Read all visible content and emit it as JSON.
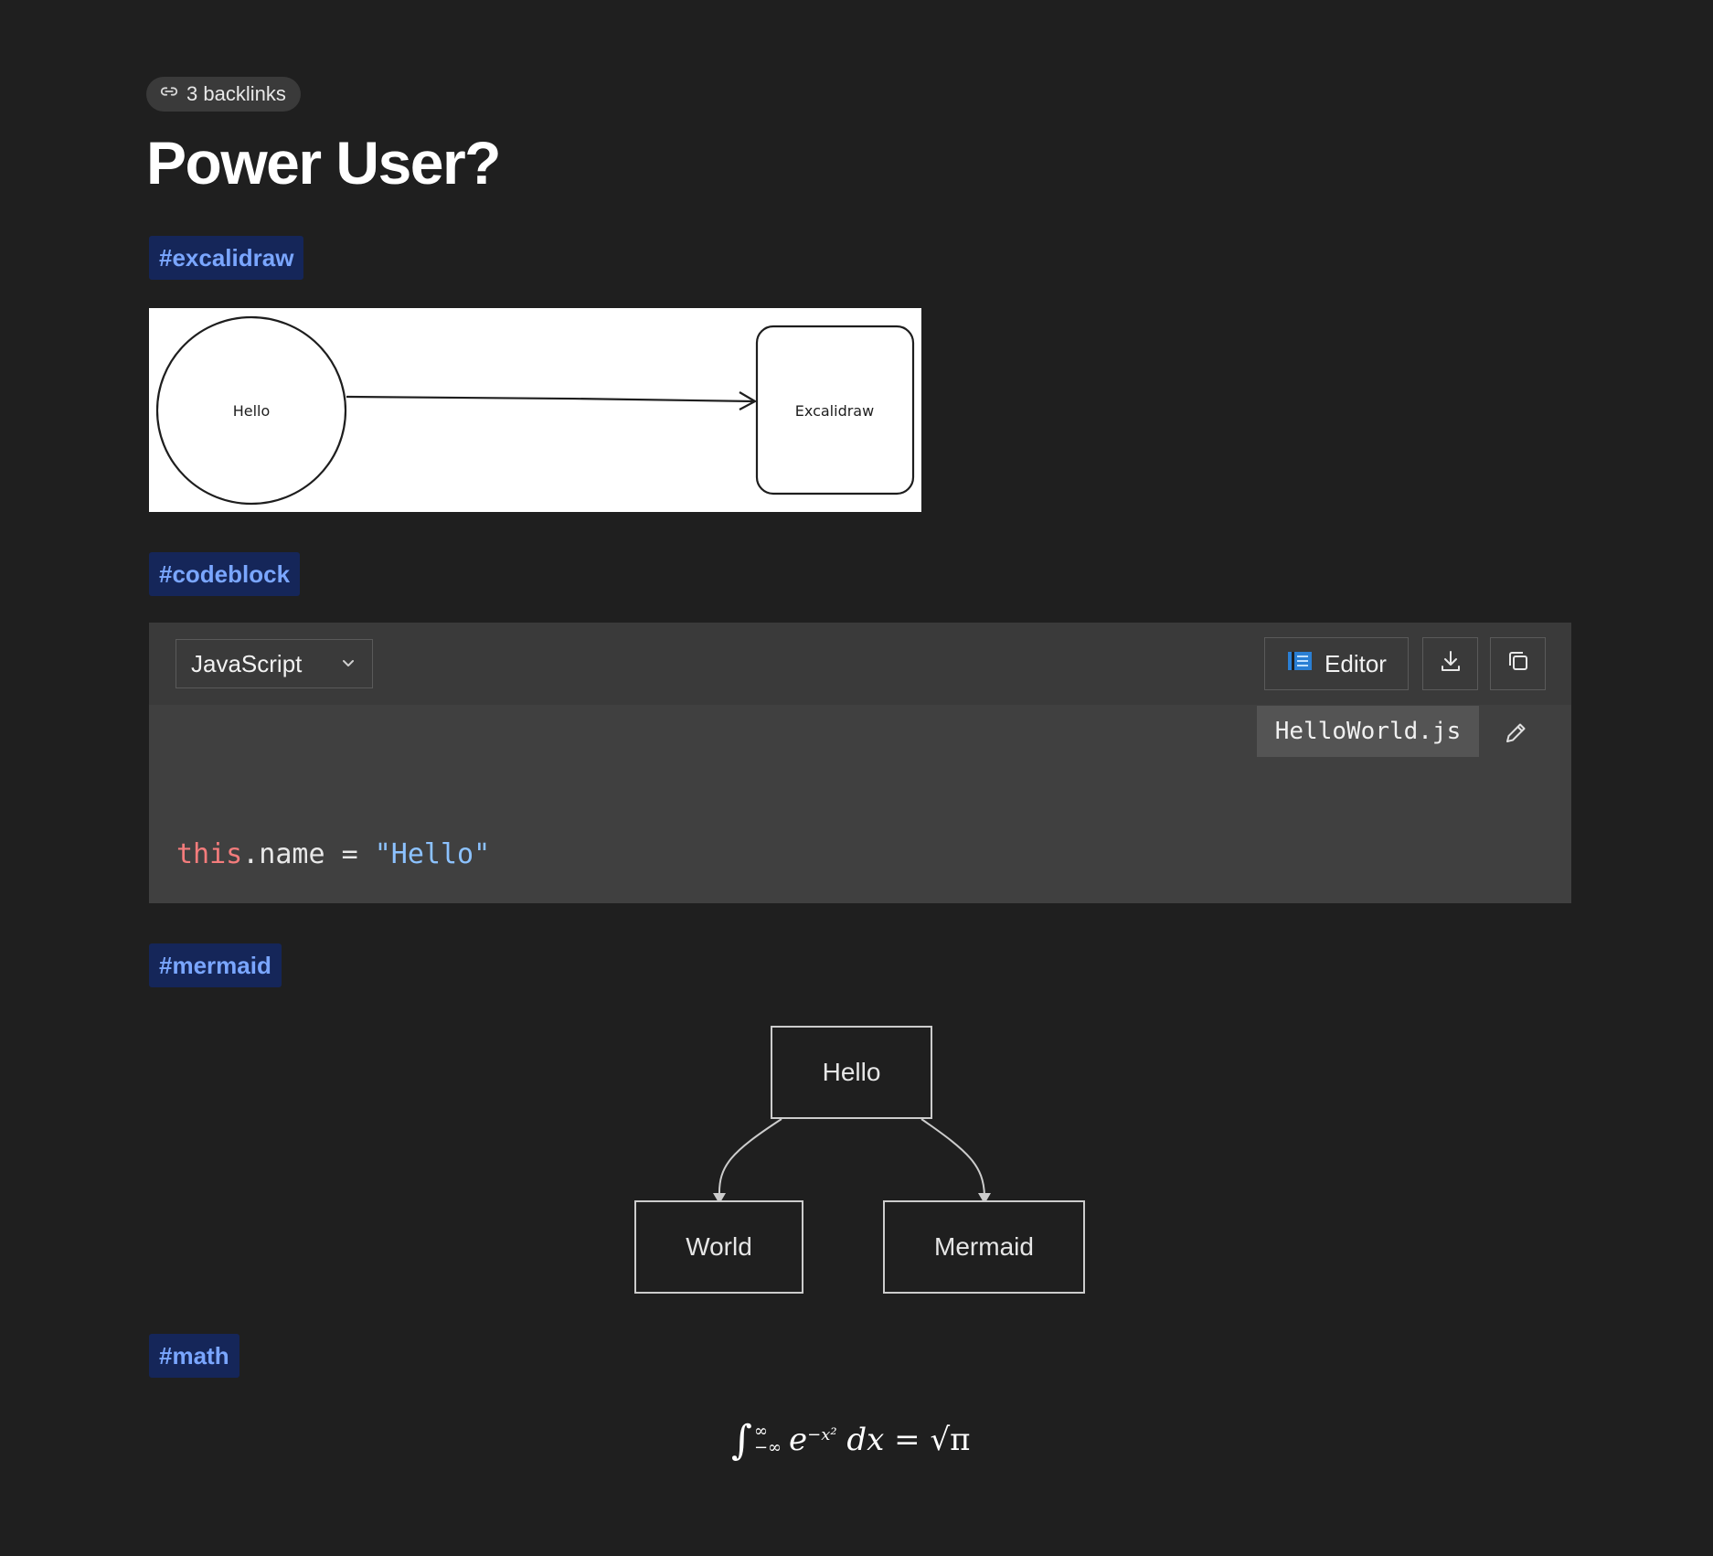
{
  "backlinks": {
    "label": "3 backlinks",
    "icon": "link-icon"
  },
  "page": {
    "title": "Power User?"
  },
  "tags": {
    "excalidraw": "#excalidraw",
    "codeblock": "#codeblock",
    "mermaid": "#mermaid",
    "math": "#math"
  },
  "excalidraw": {
    "circle_label": "Hello",
    "box_label": "Excalidraw"
  },
  "codeblock": {
    "language": "JavaScript",
    "editor_label": "Editor",
    "filename": "HelloWorld.js",
    "code": {
      "keyword": "this",
      "member": ".name = ",
      "string": "\"Hello\""
    }
  },
  "mermaid": {
    "root": "Hello",
    "left_child": "World",
    "right_child": "Mermaid"
  },
  "math": {
    "integral": "∫",
    "upper_limit": "∞",
    "lower_limit": "−∞",
    "base": "e",
    "exponent": "−x²",
    "differential": " dx = ",
    "sqrt": "√π"
  },
  "colors": {
    "background": "#1f1f1f",
    "tag_bg": "#152659",
    "tag_text": "#7aa6ff",
    "keyword": "#f47c7c",
    "string": "#8cc2ff"
  }
}
